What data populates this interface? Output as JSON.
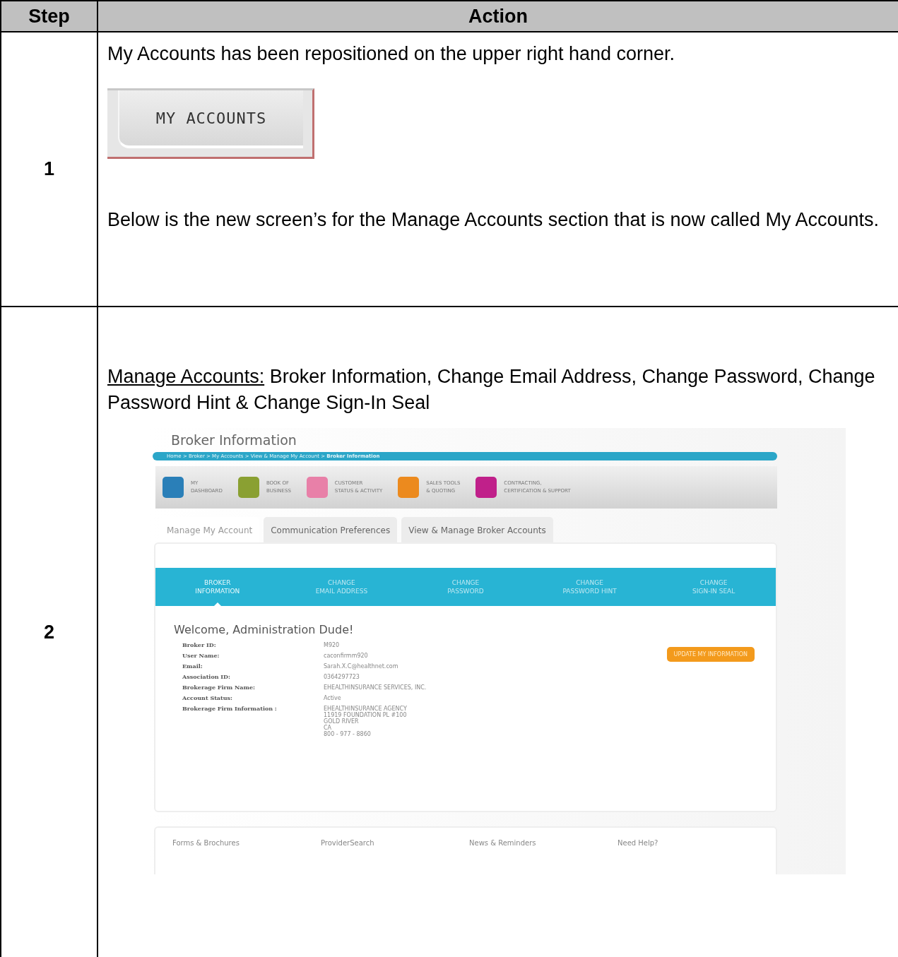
{
  "table": {
    "columns": [
      "Step",
      "Action"
    ],
    "rows": [
      {
        "kind": "intro",
        "step": "1",
        "text_before": "My Accounts has been repositioned on the upper right hand corner.",
        "button_label": "MY ACCOUNTS",
        "text_after": "Below is the new screen’s for the Manage Accounts section that is now called My Accounts."
      },
      {
        "kind": "screenshot",
        "step": "2",
        "heading_link": "Manage Accounts:",
        "heading_rest": " Broker Information, Change Email Address, Change Password, Change Password Hint & Change Sign-In Seal",
        "screenshot": {
          "page_title": "Broker Information",
          "breadcrumb": "Home > Broker > My Accounts > View & Manage My Account > **Broker Information**",
          "nav": [
            {
              "label": "MY\nDASHBOARD",
              "color": "#2a7fb8"
            },
            {
              "label": "BOOK OF\nBUSINESS",
              "color": "#8aa032"
            },
            {
              "label": "CUSTOMER\nSTATUS & ACTIVITY",
              "color": "#e880a8"
            },
            {
              "label": "SALES TOOLS\n& QUOTING",
              "color": "#ec8a1e"
            },
            {
              "label": "CONTRACTING,\nCERTIFICATION & SUPPORT",
              "color": "#c0208a"
            }
          ],
          "tabs": [
            {
              "label": "Manage My Account",
              "selected": true
            },
            {
              "label": "Communication Preferences",
              "selected": false
            },
            {
              "label": "View & Manage Broker Accounts",
              "selected": false
            }
          ],
          "subnav": [
            {
              "label": "BROKER\nINFORMATION",
              "selected": true
            },
            {
              "label": "CHANGE\nEMAIL ADDRESS",
              "selected": false
            },
            {
              "label": "CHANGE\nPASSWORD",
              "selected": false
            },
            {
              "label": "CHANGE\nPASSWORD HINT",
              "selected": false
            },
            {
              "label": "CHANGE\nSIGN-IN SEAL",
              "selected": false
            }
          ],
          "welcome": "Welcome, Administration Dude!",
          "fields": [
            {
              "label": "Broker ID:",
              "value": "M920"
            },
            {
              "label": "User Name:",
              "value": "caconfirmm920"
            },
            {
              "label": "Email:",
              "value": "Sarah.X.C@healthnet.com"
            },
            {
              "label": "Association ID:",
              "value": "0364297723"
            },
            {
              "label": "Brokerage Firm Name:",
              "value": "EHEALTHINSURANCE SERVICES, INC."
            },
            {
              "label": "Account Status:",
              "value": "Active"
            },
            {
              "label": "Brokerage Firm Information :",
              "value": "EHEALTHINSURANCE AGENCY\n11919 FOUNDATION PL #100\nGOLD RIVER\nCA\n800 - 977 - 8860"
            }
          ],
          "update_button": "UPDATE MY INFORMATION",
          "footer_links": [
            "Forms & Brochures",
            "ProviderSearch",
            "News & Reminders",
            "Need Help?"
          ]
        }
      }
    ]
  }
}
